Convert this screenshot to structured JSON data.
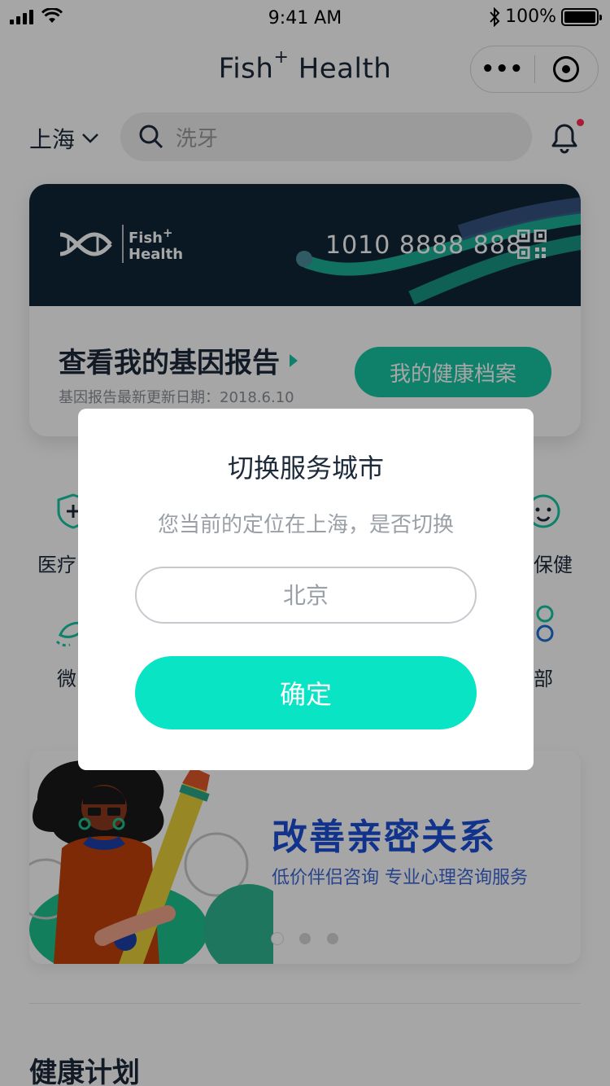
{
  "status_bar": {
    "time": "9:41 AM",
    "battery": "100%",
    "battery_level": 1.0
  },
  "nav": {
    "title": "Fish",
    "title_sup": "+",
    "title_suffix": " Health",
    "capsule_dots": "•••"
  },
  "location": {
    "city": "上海"
  },
  "search": {
    "placeholder": "洗牙"
  },
  "member_card": {
    "logo_line1": "Fish",
    "logo_sup": "+",
    "logo_line2": "Health",
    "number": "1010 8888 888",
    "report_title": "查看我的基因报告",
    "report_date": "基因报告最新更新日期：2018.6.10",
    "health_button": "我的健康档案"
  },
  "quick_menu": {
    "item1": "医疗",
    "item2": "保健",
    "item3": "微",
    "item4": "部"
  },
  "banner": {
    "title": "改善亲密关系",
    "subtitle": "低价伴侣咨询 专业心理咨询服务",
    "active_index": 0,
    "count": 3
  },
  "section": {
    "title": "健康计划"
  },
  "modal": {
    "title": "切换服务城市",
    "message": "您当前的定位在上海，是否切换",
    "input_placeholder": "北京",
    "confirm": "确定"
  },
  "colors": {
    "accent": "#18c6a5",
    "confirm": "#08e4c4",
    "card_dark": "#0f2636",
    "banner_title": "#1d4fd8"
  }
}
